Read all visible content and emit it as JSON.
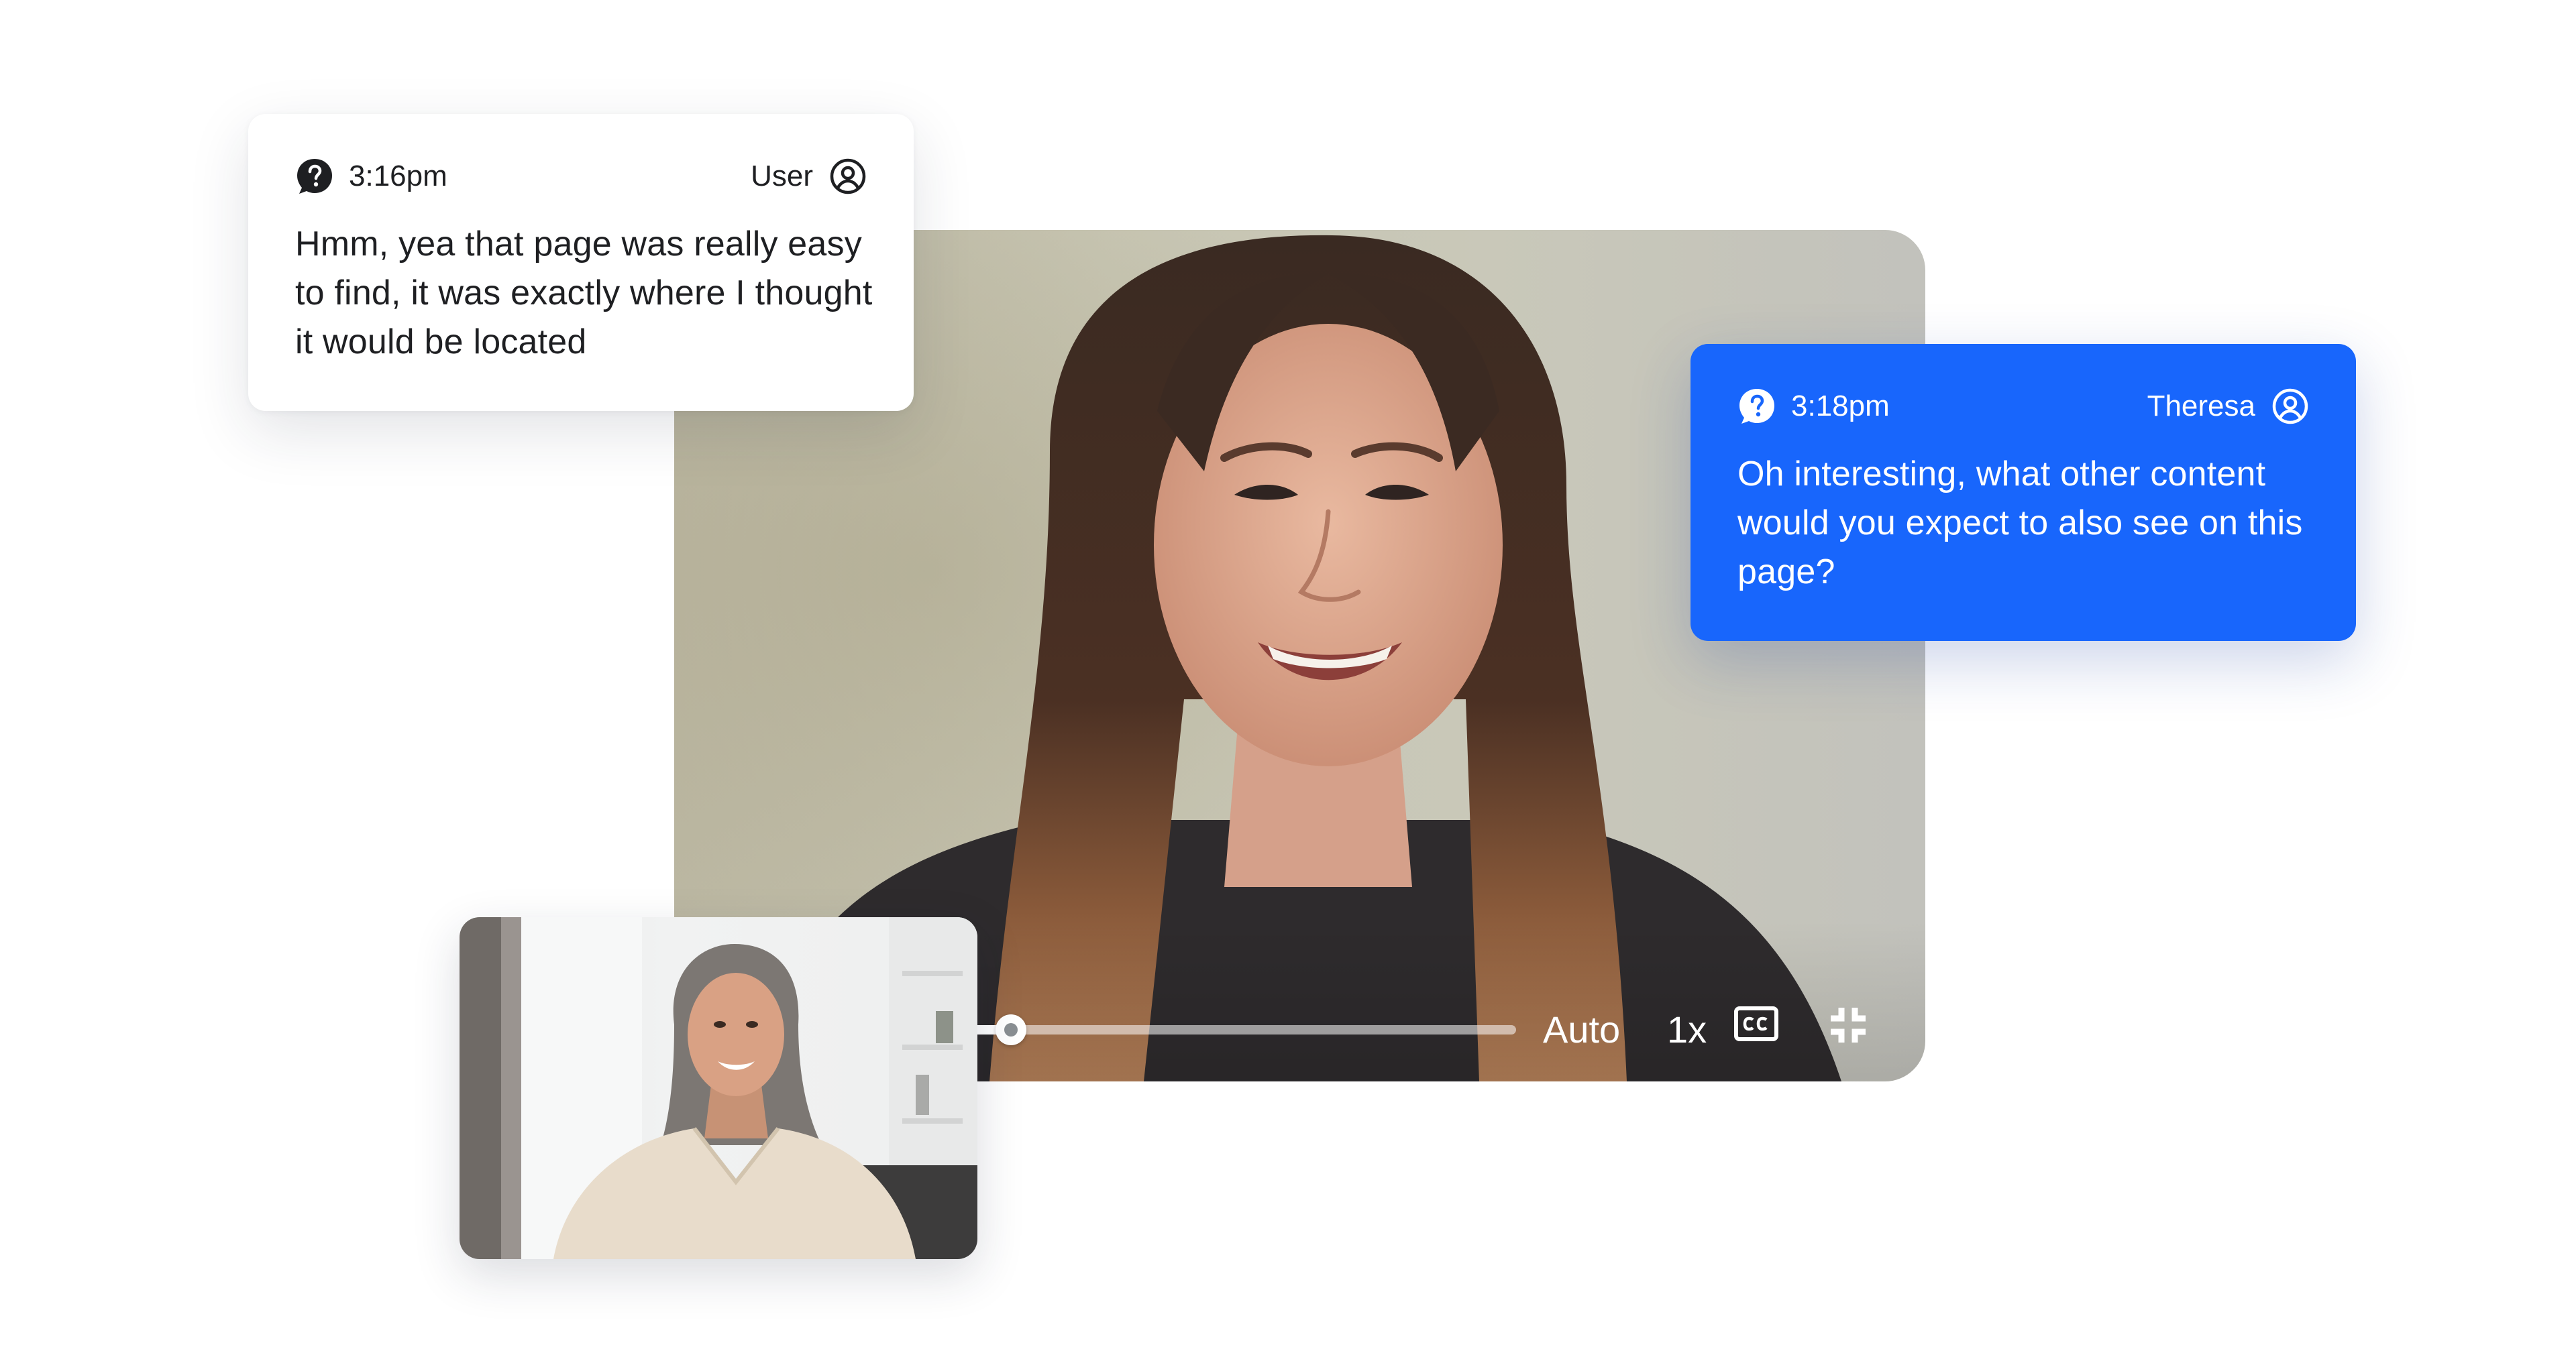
{
  "user_message": {
    "time": "3:16pm",
    "author": "User",
    "text": "Hmm, yea that page was really easy to find, it was exactly where I thought it would be located",
    "icon": "question-bubble-icon",
    "avatar_icon": "user-circle-icon"
  },
  "moderator_message": {
    "time": "3:18pm",
    "author": "Theresa",
    "text": "Oh interesting, what other content would you expect to also see on this page?",
    "icon": "question-bubble-icon",
    "avatar_icon": "user-circle-icon",
    "color": "#1866fc"
  },
  "player": {
    "progress": 0.4,
    "quality": "Auto",
    "speed": "1x",
    "captions_icon": "closed-captions-icon",
    "fullscreen_icon": "exit-fullscreen-icon"
  }
}
